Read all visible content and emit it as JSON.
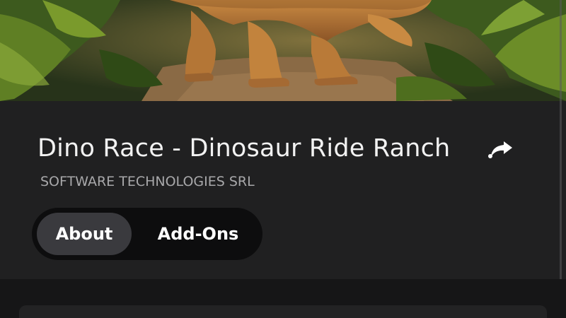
{
  "game": {
    "title": "Dino Race - Dinosaur Ride Ranch",
    "publisher": "SOFTWARE TECHNOLOGIES SRL"
  },
  "tabs": [
    {
      "label": "About",
      "selected": true
    },
    {
      "label": "Add-Ons",
      "selected": false
    }
  ],
  "icons": {
    "share": "share-arrow-icon"
  },
  "colors": {
    "background": "#202021",
    "tab_selected": "#3a3a3e",
    "tab_bar": "#0d0d0e",
    "publisher_text": "#a8a8aa"
  }
}
